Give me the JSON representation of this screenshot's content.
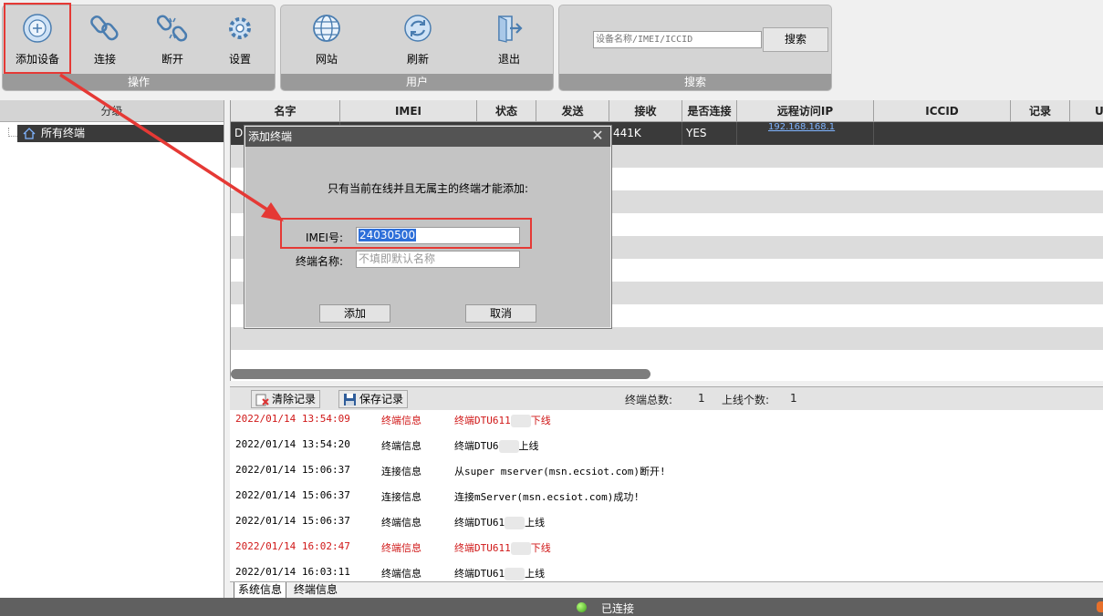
{
  "toolbar": {
    "groups": [
      {
        "caption": "操作",
        "buttons": [
          "添加设备",
          "连接",
          "断开",
          "设置"
        ]
      },
      {
        "caption": "用户",
        "buttons": [
          "网站",
          "刷新",
          "退出"
        ]
      },
      {
        "caption": "搜索"
      }
    ],
    "search_placeholder": "设备名称/IMEI/ICCID",
    "search_button": "搜索"
  },
  "left_pane": {
    "header": "分级",
    "tree_root": "所有终端"
  },
  "grid": {
    "columns": [
      "名字",
      "IMEI",
      "状态",
      "发送",
      "接收",
      "是否连接",
      "远程访问IP",
      "ICCID",
      "记录",
      "US"
    ],
    "selected_row": {
      "name": "D",
      "receive": "441K",
      "connected": "YES",
      "remote_ip": "192.168.168.1"
    }
  },
  "dialog": {
    "title": "添加终端",
    "message": "只有当前在线并且无属主的终端才能添加:",
    "imei_label": "IMEI号:",
    "imei_value": "24030500",
    "name_label": "终端名称:",
    "name_placeholder": "不填即默认名称",
    "add_button": "添加",
    "cancel_button": "取消"
  },
  "log_toolbar": {
    "clear_label": "清除记录",
    "save_label": "保存记录",
    "total_label": "终端总数:",
    "total_value": "1",
    "online_label": "上线个数:",
    "online_value": "1"
  },
  "logs": [
    {
      "time": "2022/01/14 13:54:09",
      "type": "终端信息",
      "prefix": "终端DTU611",
      "suffix": "下线",
      "red": true
    },
    {
      "time": "2022/01/14 13:54:20",
      "type": "终端信息",
      "prefix": "终端DTU6",
      "suffix": "上线",
      "red": false
    },
    {
      "time": "2022/01/14 15:06:37",
      "type": "连接信息",
      "prefix": "从super mserver(msn.ecsiot.com)断开!",
      "suffix": "",
      "red": false
    },
    {
      "time": "2022/01/14 15:06:37",
      "type": "连接信息",
      "prefix": "连接mServer(msn.ecsiot.com)成功!",
      "suffix": "",
      "red": false
    },
    {
      "time": "2022/01/14 15:06:37",
      "type": "终端信息",
      "prefix": "终端DTU61",
      "suffix": "上线",
      "red": false
    },
    {
      "time": "2022/01/14 16:02:47",
      "type": "终端信息",
      "prefix": "终端DTU611",
      "suffix": "下线",
      "red": true
    },
    {
      "time": "2022/01/14 16:03:11",
      "type": "终端信息",
      "prefix": "终端DTU61",
      "suffix": "上线",
      "red": false
    }
  ],
  "tabs": [
    "系统信息",
    "终端信息"
  ],
  "status": {
    "text": "已连接"
  },
  "colors": {
    "annotation": "#e53935",
    "log_red": "#d01818"
  }
}
